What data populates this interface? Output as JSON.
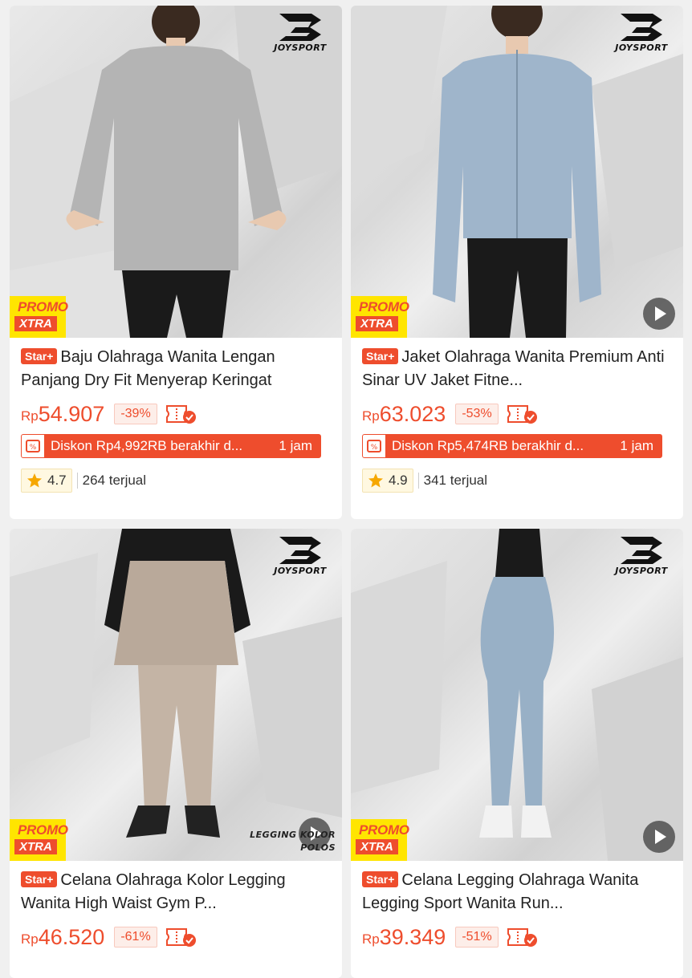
{
  "products": [
    {
      "brand": "JOYSPORT",
      "badge": "Star+",
      "title": "Baju Olahraga Wanita Lengan Panjang Dry Fit Menyerap Keringat",
      "price_currency": "Rp",
      "price": "54.907",
      "discount": "-39%",
      "flash_text": "Diskon Rp4,992RB berakhir d...",
      "flash_time": "1 jam",
      "rating": "4.7",
      "sold": "264 terjual",
      "promo_top": "PROMO",
      "promo_bottom": "XTRA",
      "has_video": false,
      "product_color": "#b4b4b4",
      "bottom_color": "#1a1a1a"
    },
    {
      "brand": "JOYSPORT",
      "badge": "Star+",
      "title": "Jaket Olahraga Wanita Premium Anti Sinar UV Jaket Fitne...",
      "price_currency": "Rp",
      "price": "63.023",
      "discount": "-53%",
      "flash_text": "Diskon Rp5,474RB berakhir d...",
      "flash_time": "1 jam",
      "rating": "4.9",
      "sold": "341 terjual",
      "promo_top": "PROMO",
      "promo_bottom": "XTRA",
      "has_video": true,
      "product_color": "#9fb5cb",
      "bottom_color": "#1a1a1a"
    },
    {
      "brand": "JOYSPORT",
      "badge": "Star+",
      "title": "Celana Olahraga Kolor Legging Wanita High Waist Gym P...",
      "price_currency": "Rp",
      "price": "46.520",
      "discount": "-61%",
      "promo_top": "PROMO",
      "promo_bottom": "XTRA",
      "has_video": true,
      "overlay_caption_1": "LEGGING KOLOR",
      "overlay_caption_2": "POLOS",
      "product_color": "#b9a99a",
      "bottom_color": "#1a1a1a"
    },
    {
      "brand": "JOYSPORT",
      "badge": "Star+",
      "title": "Celana Legging Olahraga Wanita Legging Sport Wanita Run...",
      "price_currency": "Rp",
      "price": "39.349",
      "discount": "-51%",
      "promo_top": "PROMO",
      "promo_bottom": "XTRA",
      "has_video": true,
      "product_color": "#98b0c6",
      "bottom_color": "#1a1a1a"
    }
  ],
  "colors": {
    "accent": "#ee4d2d",
    "promo_yellow": "#ffe500",
    "rating_star": "#f6a700"
  }
}
